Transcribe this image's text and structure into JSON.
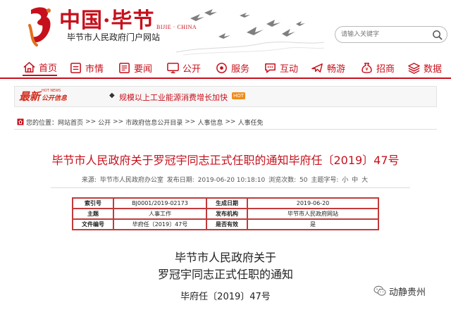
{
  "header": {
    "logo_title": "中国·毕节",
    "logo_en": "BIJIE · CHINA",
    "logo_sub": "毕节市人民政府门户网站",
    "search_placeholder": "请输入关键字"
  },
  "nav": {
    "items": [
      {
        "label": "首页",
        "icon": "home-icon"
      },
      {
        "label": "市情",
        "icon": "city-icon"
      },
      {
        "label": "要闻",
        "icon": "news-icon"
      },
      {
        "label": "公开",
        "icon": "monitor-icon"
      },
      {
        "label": "服务",
        "icon": "service-icon"
      },
      {
        "label": "互动",
        "icon": "chat-icon"
      },
      {
        "label": "畅游",
        "icon": "plane-icon"
      },
      {
        "label": "招商",
        "icon": "money-bag-icon"
      },
      {
        "label": "数据",
        "icon": "layers-icon"
      }
    ],
    "active_color": "#c6101c"
  },
  "ticker": {
    "logo_big": "最新",
    "logo_en": "HOT NEWS",
    "logo_small": "公开信息",
    "bullet": "◆",
    "text": "规模以上工业能源消费增长加快",
    "badge": "HOT"
  },
  "breadcrumb": {
    "prefix": "您的位置：",
    "items": [
      "网站首页",
      "公开",
      "市政府信息公开目录",
      "人事信息",
      "人事任免"
    ],
    "separator": ">>"
  },
  "article": {
    "title": "毕节市人民政府关于罗冠宇同志正式任职的通知毕府任〔2019〕47号",
    "meta": {
      "source_label": "来源:",
      "source": "毕节市人民政府办公室",
      "date_label": "发布日期:",
      "date": "2019-06-20 10:18:10",
      "views_label": "浏览次数:",
      "views": "50",
      "font_label": "主题字号:",
      "font_small": "小",
      "font_medium": "中",
      "font_large": "大"
    },
    "info_table": {
      "rows": [
        [
          "索引号",
          "BJ0001/2019-02173",
          "生成日期",
          "2019-06-20"
        ],
        [
          "主题",
          "人事工作",
          "发布机构",
          "毕节市人民政府网站"
        ],
        [
          "文件编号",
          "毕府任〔2019〕47号",
          "是否有效",
          "是"
        ]
      ]
    },
    "heading_line1": "毕节市人民政府关于",
    "heading_line2": "罗冠宇同志正式任职的通知",
    "doc_number": "毕府任〔2019〕47号"
  },
  "watermark": {
    "text": "动静贵州",
    "icon": "wechat-icon"
  },
  "colors": {
    "brand_red": "#c6101c",
    "ticker_orange": "#f08a18",
    "table_border": "#c23b3b"
  }
}
